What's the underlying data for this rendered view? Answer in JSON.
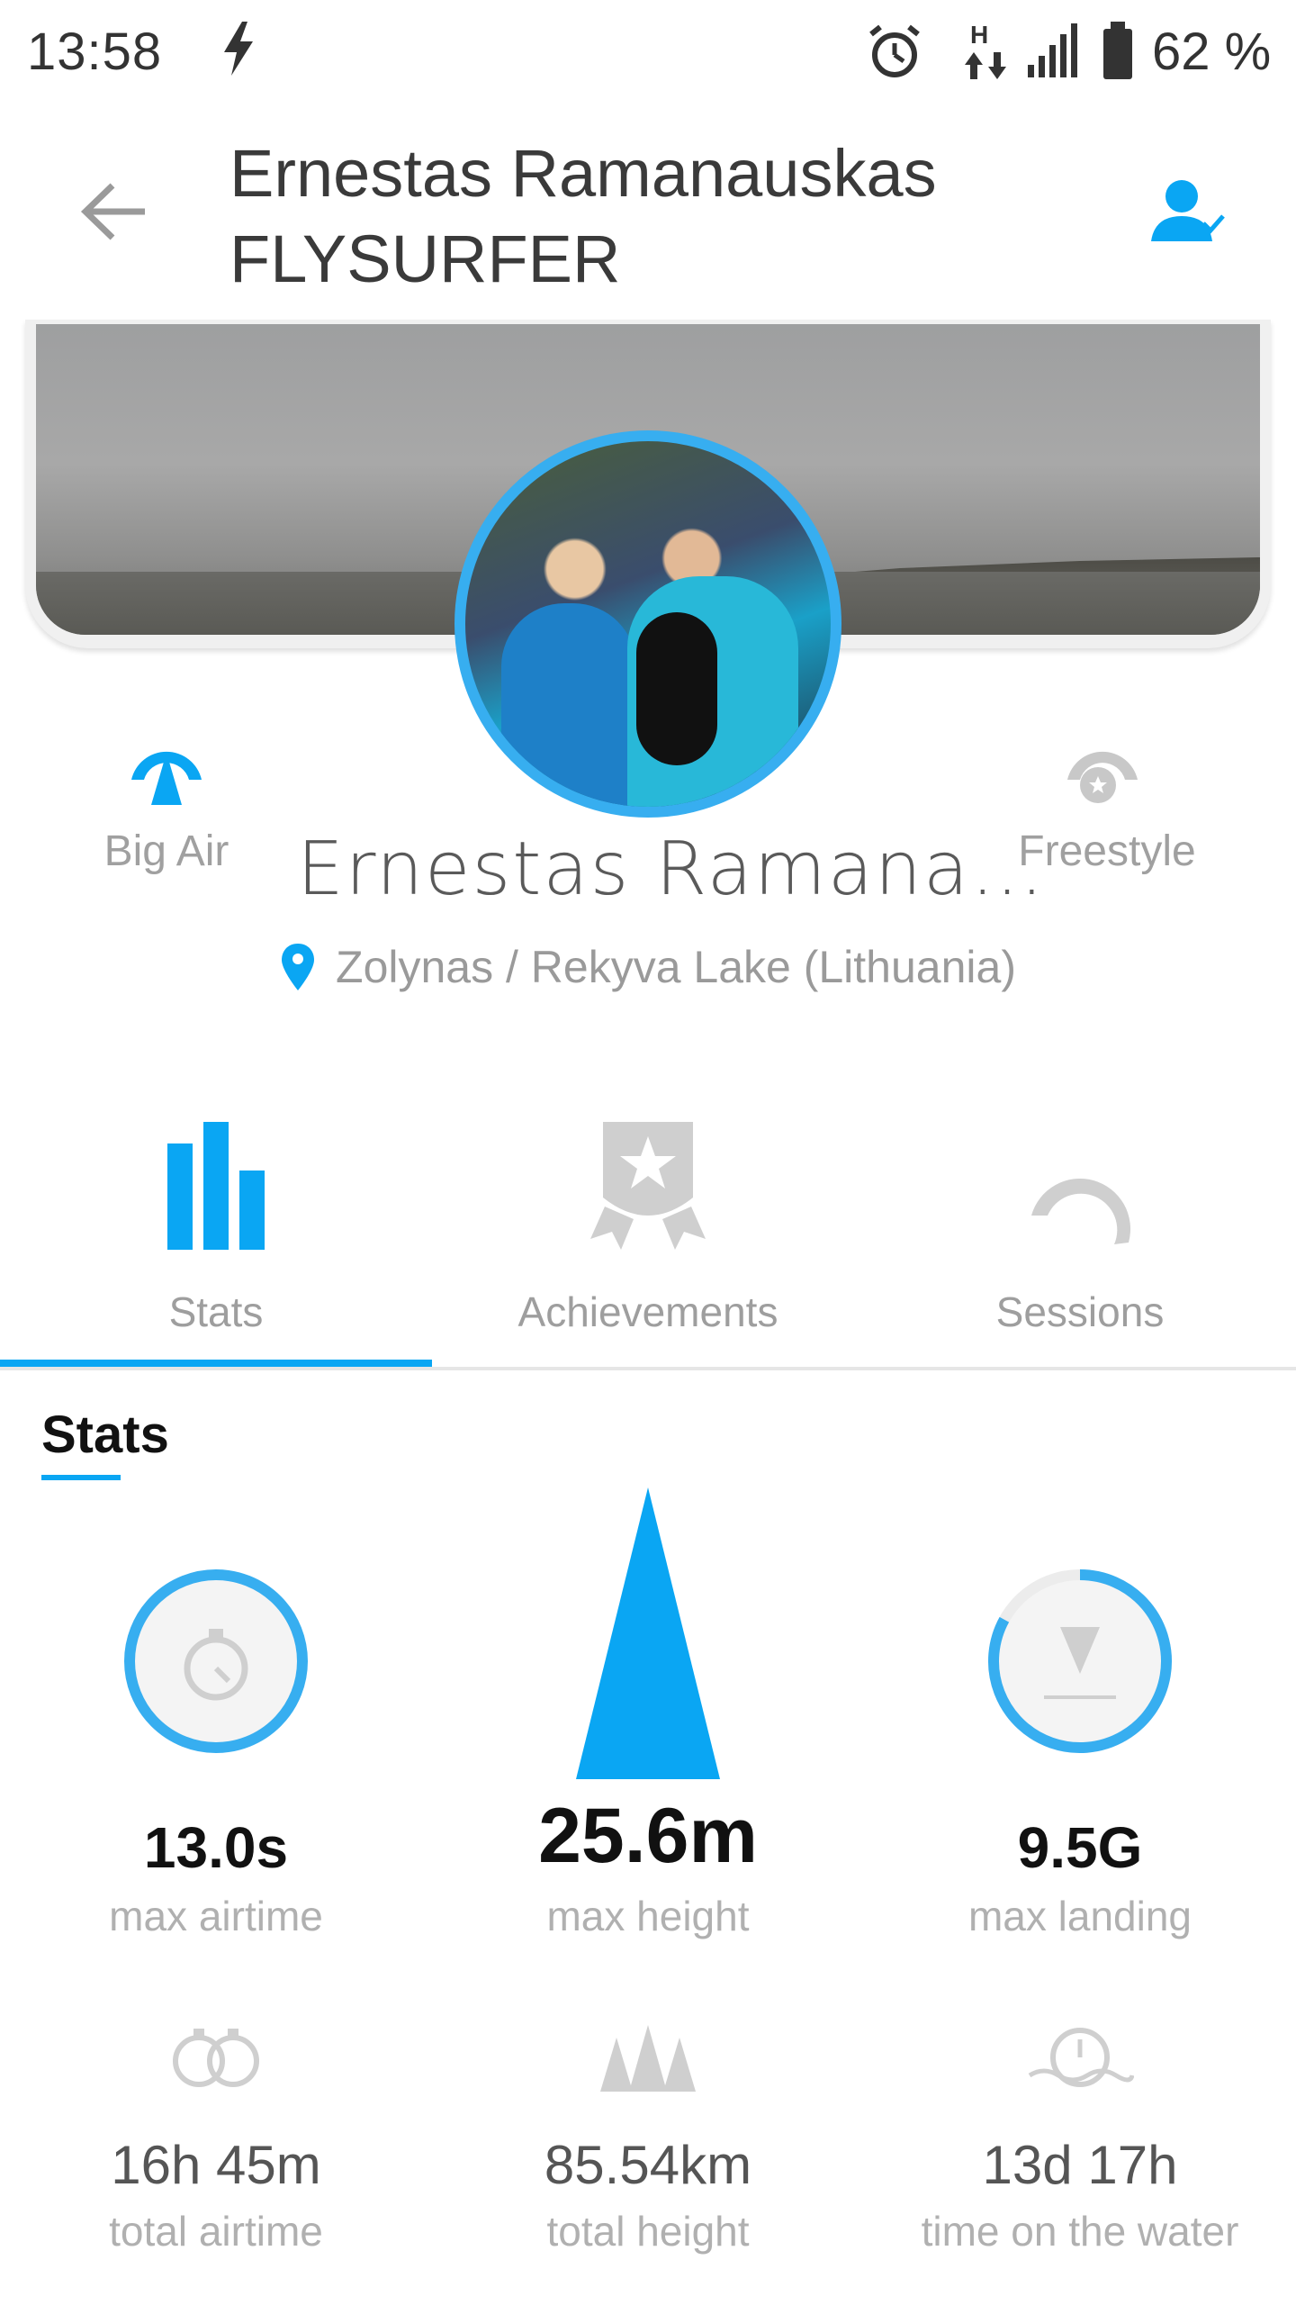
{
  "status_bar": {
    "time": "13:58",
    "battery": "62 %",
    "network": "H"
  },
  "header": {
    "title_line1": "Ernestas Ramanauskas",
    "title_line2": "FLYSURFER"
  },
  "profile": {
    "name": "Ernestas Ramana…",
    "location": "Zolynas / Rekyva Lake (Lithuania)",
    "disciplines": [
      {
        "label": "Big Air",
        "icon": "big-air-icon",
        "active": true
      },
      {
        "label": "Freestyle",
        "icon": "freestyle-icon",
        "active": false
      }
    ]
  },
  "tabs": [
    {
      "label": "Stats",
      "icon": "stats-bars-icon",
      "active": true
    },
    {
      "label": "Achievements",
      "icon": "achievement-badge-icon",
      "active": false
    },
    {
      "label": "Sessions",
      "icon": "session-arc-icon",
      "active": false
    }
  ],
  "stats": {
    "section_title": "Stats",
    "max_airtime": {
      "value": "13.0s",
      "label": "max airtime"
    },
    "max_height": {
      "value": "25.6m",
      "label": "max height"
    },
    "max_landing": {
      "value": "9.5G",
      "label": "max landing",
      "ring_fill": 0.83
    },
    "total_airtime": {
      "value": "16h 45m",
      "label": "total airtime"
    },
    "total_height": {
      "value": "85.54km",
      "label": "total height"
    },
    "time_on_water": {
      "value": "13d 17h",
      "label": "time on the water"
    }
  },
  "colors": {
    "accent": "#0aa6f3",
    "ring": "#37aef0",
    "muted": "#a0a0a0"
  }
}
